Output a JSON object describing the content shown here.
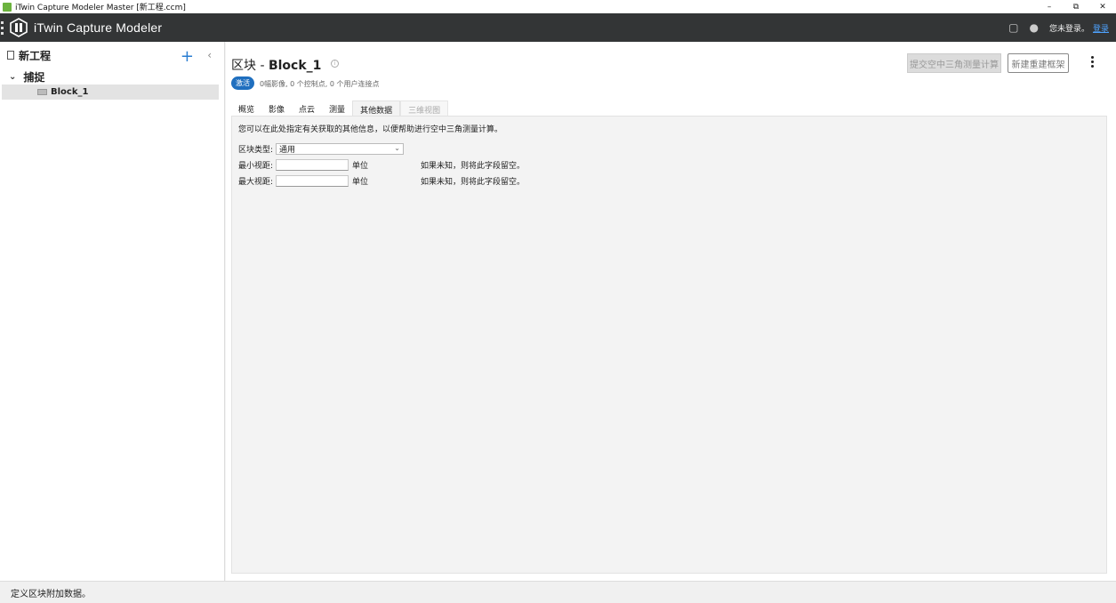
{
  "window": {
    "title": "iTwin Capture Modeler Master [新工程.ccm]",
    "controls": {
      "minimize": "–",
      "restore": "⧉",
      "close": "✕"
    }
  },
  "appbar": {
    "app_name": "iTwin Capture Modeler",
    "login_text": "您未登录。",
    "login_link": "登录"
  },
  "sidebar": {
    "project_name": "新工程",
    "add_icon": "+",
    "collapse_icon": "‹",
    "tree": {
      "group_label": "捕捉",
      "chevron": "⌄",
      "items": [
        {
          "label": "Block_1"
        }
      ]
    }
  },
  "main": {
    "title_prefix": "区块 - ",
    "title_name": "Block_1",
    "submit_button": "提交空中三角测量计算",
    "new_button": "新建重建框架",
    "status_badge": "激活",
    "stats": "0幅影像, 0 个控制点, 0 个用户连接点",
    "tabs": [
      {
        "label": "概览",
        "state": "normal"
      },
      {
        "label": "影像",
        "state": "normal"
      },
      {
        "label": "点云",
        "state": "normal"
      },
      {
        "label": "测量",
        "state": "normal"
      },
      {
        "label": "其他数据",
        "state": "active"
      },
      {
        "label": "三维视图",
        "state": "disabled"
      }
    ],
    "panel": {
      "description": "您可以在此处指定有关获取的其他信息，以便帮助进行空中三角测量计算。",
      "block_type_label": "区块类型:",
      "block_type_value": "通用",
      "min_distance_label": "最小视距:",
      "min_distance_value": "",
      "min_distance_unit": "单位",
      "min_distance_hint": "如果未知，则将此字段留空。",
      "max_distance_label": "最大视距:",
      "max_distance_value": "",
      "max_distance_unit": "单位",
      "max_distance_hint": "如果未知，则将此字段留空。"
    }
  },
  "statusbar": {
    "text": "定义区块附加数据。"
  },
  "colors": {
    "accent": "#1f6fbf",
    "header_bg": "#333536",
    "plus": "#2a7dd1"
  }
}
